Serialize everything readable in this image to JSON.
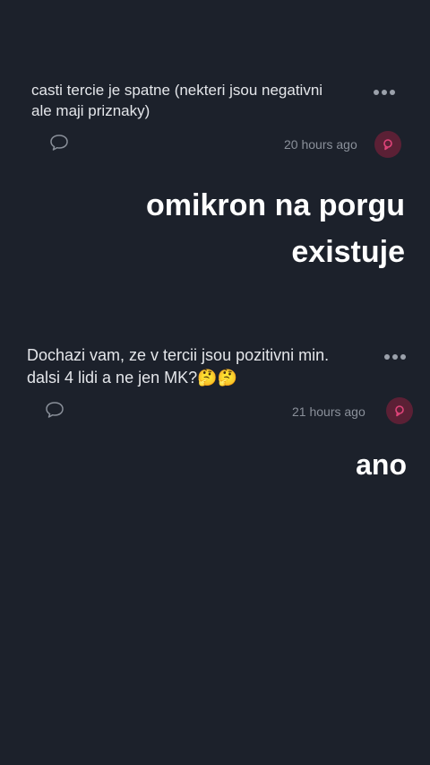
{
  "posts": [
    {
      "text_line1": "casti tercie je spatne (nekteri jsou negativni",
      "text_line2": "ale maji priznaky)",
      "timestamp": "20 hours ago",
      "comment_icon": "speech-bubble-icon",
      "more_icon": "ellipsis-icon",
      "avatar_icon": "avatar-icon"
    },
    {
      "text_line1": "Dochazi vam, ze v tercii jsou pozitivni min.",
      "text_line2": "dalsi 4 lidi a ne jen MK?🤔🤔",
      "timestamp": "21 hours ago",
      "comment_icon": "speech-bubble-icon",
      "more_icon": "ellipsis-icon",
      "avatar_icon": "avatar-icon"
    }
  ],
  "replies": [
    {
      "line1": "omikron na porgu",
      "line2": "existuje"
    },
    {
      "line1": "ano"
    }
  ],
  "colors": {
    "background": "#1c212b",
    "avatar": "#5b2035",
    "avatar_glyph": "#e0447a",
    "muted": "#8a909a"
  }
}
